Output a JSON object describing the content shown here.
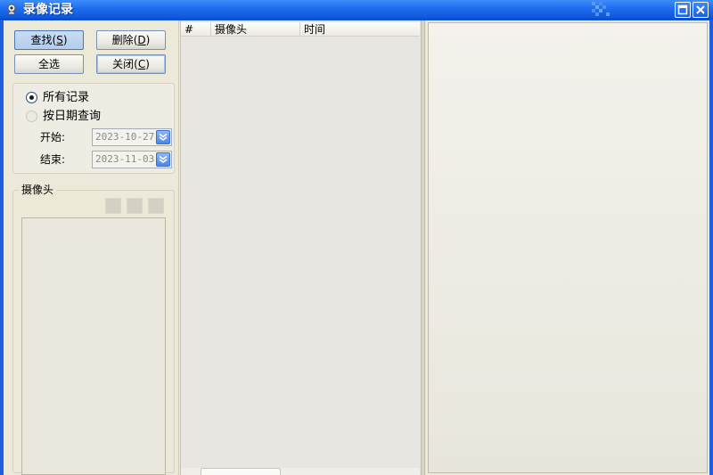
{
  "window": {
    "title": "录像记录",
    "title_icon": "camera-app-icon",
    "controls": {
      "maximize": "maximize-icon",
      "close": "close-icon"
    }
  },
  "toolbar": {
    "search_label": "查找",
    "search_key": "S",
    "delete_label": "删除",
    "delete_key": "D",
    "select_all_label": "全选",
    "close_label": "关闭",
    "close_key": "C"
  },
  "filter": {
    "all_records_label": "所有记录",
    "by_date_label": "按日期查询",
    "selected": "all_records",
    "start_label": "开始:",
    "start_value": "2023-10-27",
    "end_label": "结束:",
    "end_value": "2023-11-03"
  },
  "camera_group": {
    "legend": "摄像头"
  },
  "record_list": {
    "columns": [
      "#",
      "摄像头",
      "时间"
    ],
    "rows": []
  },
  "colors": {
    "titlebar": "#1F6DEF",
    "face": "#ECE9D8",
    "accent": "#4D86E6"
  }
}
